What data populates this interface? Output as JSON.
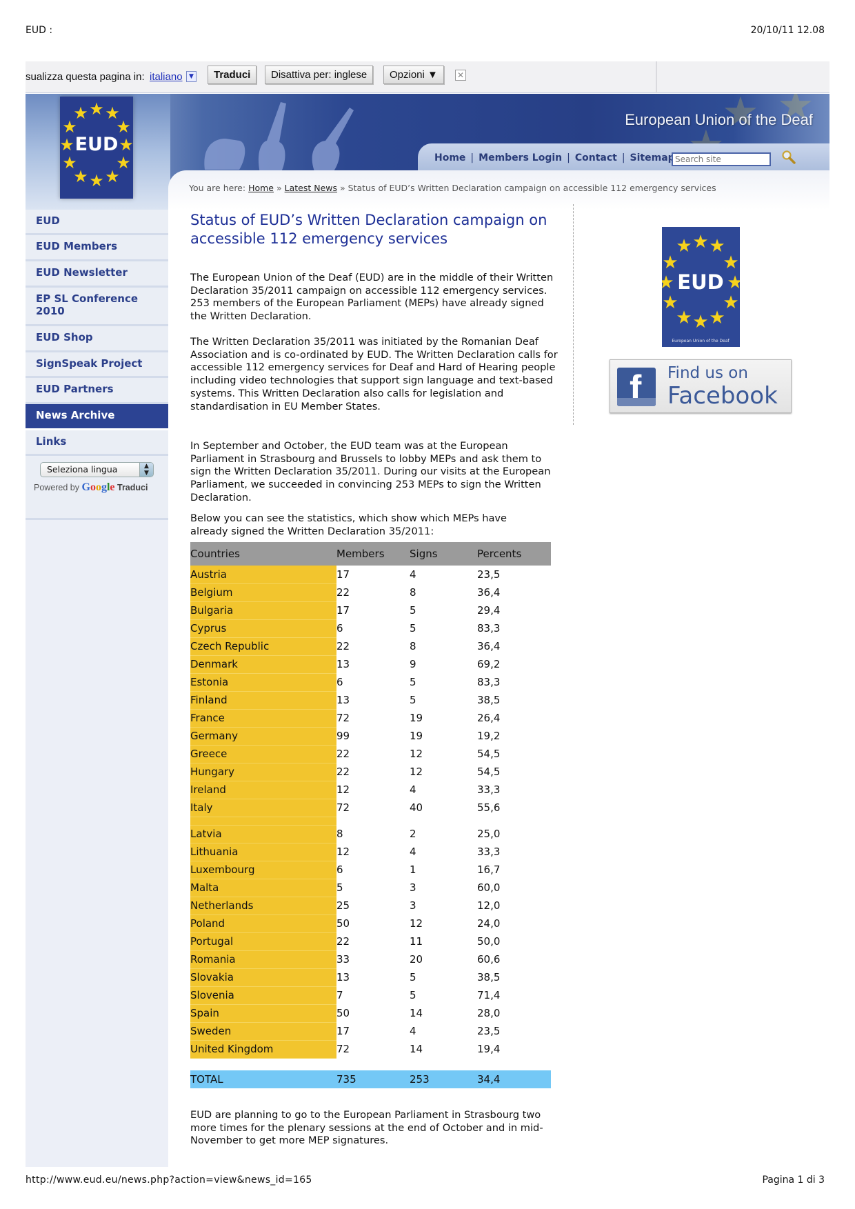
{
  "print_header": {
    "title": "EUD :",
    "datetime": "20/10/11 12.08"
  },
  "print_footer": {
    "url": "http://www.eud.eu/news.php?action=view&news_id=165",
    "page": "Pagina 1 di 3"
  },
  "translate_bar": {
    "label": "sualizza questa pagina in:",
    "language": "italiano",
    "translate_button": "Traduci",
    "disable_button": "Disattiva per: inglese",
    "options_button": "Opzioni ▼",
    "close_glyph": "✕"
  },
  "header": {
    "logo_text": "EUD",
    "site_title": "European Union of the Deaf",
    "nav": [
      "Home",
      "Members Login",
      "Contact",
      "Sitemap"
    ],
    "nav_separator": "|",
    "search_placeholder": "Search site"
  },
  "breadcrumb": {
    "prefix": "You are here:",
    "home": "Home",
    "sep": "»",
    "latest": "Latest News",
    "current": "Status of EUD’s Written Declaration campaign on accessible 112 emergency services"
  },
  "sidebar": {
    "items": [
      {
        "label": "EUD",
        "active": false
      },
      {
        "label": "EUD Members",
        "active": false
      },
      {
        "label": "EUD Newsletter",
        "active": false
      },
      {
        "label": "EP SL Conference 2010",
        "active": false
      },
      {
        "label": "EUD Shop",
        "active": false
      },
      {
        "label": "SignSpeak Project",
        "active": false
      },
      {
        "label": "EUD Partners",
        "active": false
      },
      {
        "label": "News Archive",
        "active": true
      },
      {
        "label": "Links",
        "active": false
      }
    ],
    "language_select": "Seleziona lingua",
    "powered_by": "Powered by",
    "google": "Google",
    "traduci": "Traduci"
  },
  "article": {
    "title": "Status of EUD’s Written Declaration campaign on accessible 112 emergency services",
    "paragraphs": [
      "The European Union of the Deaf (EUD) are in the middle of their Written Declaration 35/2011 campaign on accessible 112 emergency services. 253 members of the European Parliament (MEPs) have already signed the Written Declaration.",
      "The Written Declaration 35/2011 was initiated by the Romanian Deaf Association and is co-ordinated by EUD. The Written Declaration calls for accessible 112 emergency services for Deaf and Hard of Hearing people including video technologies that support sign language and text-based systems. This Written Declaration also calls for legislation and standardisation in EU Member States.",
      "In September and October, the EUD team was at the European Parliament in Strasbourg and Brussels to lobby MEPs and ask them to sign the Written Declaration 35/2011. During our visits at the European Parliament, we succeeded in convincing 253 MEPs to sign the Written Declaration.",
      "Below you can see the statistics, which show which MEPs have already signed the Written Declaration 35/2011:"
    ],
    "closing": "EUD are planning to go to the European Parliament in Strasbourg two more times for the plenary sessions at the end of October and in mid-November to get more MEP signatures."
  },
  "table": {
    "headers": [
      "Countries",
      "Members",
      "Signs",
      "Percents"
    ],
    "rows": [
      [
        "Austria",
        "17",
        "4",
        "23,5"
      ],
      [
        "Belgium",
        "22",
        "8",
        "36,4"
      ],
      [
        "Bulgaria",
        "17",
        "5",
        "29,4"
      ],
      [
        "Cyprus",
        "6",
        "5",
        "83,3"
      ],
      [
        "Czech Republic",
        "22",
        "8",
        "36,4"
      ],
      [
        "Denmark",
        "13",
        "9",
        "69,2"
      ],
      [
        "Estonia",
        "6",
        "5",
        "83,3"
      ],
      [
        "Finland",
        "13",
        "5",
        "38,5"
      ],
      [
        "France",
        "72",
        "19",
        "26,4"
      ],
      [
        "Germany",
        "99",
        "19",
        "19,2"
      ],
      [
        "Greece",
        "22",
        "12",
        "54,5"
      ],
      [
        "Hungary",
        "22",
        "12",
        "54,5"
      ],
      [
        "Ireland",
        "12",
        "4",
        "33,3"
      ],
      [
        "Italy",
        "72",
        "40",
        "55,6"
      ],
      [
        "Latvia",
        "8",
        "2",
        "25,0"
      ],
      [
        "Lithuania",
        "12",
        "4",
        "33,3"
      ],
      [
        "Luxembourg",
        "6",
        "1",
        "16,7"
      ],
      [
        "Malta",
        "5",
        "3",
        "60,0"
      ],
      [
        "Netherlands",
        "25",
        "3",
        "12,0"
      ],
      [
        "Poland",
        "50",
        "12",
        "24,0"
      ],
      [
        "Portugal",
        "22",
        "11",
        "50,0"
      ],
      [
        "Romania",
        "33",
        "20",
        "60,6"
      ],
      [
        "Slovakia",
        "13",
        "5",
        "38,5"
      ],
      [
        "Slovenia",
        "7",
        "5",
        "71,4"
      ],
      [
        "Spain",
        "50",
        "14",
        "28,0"
      ],
      [
        "Sweden",
        "17",
        "4",
        "23,5"
      ],
      [
        "United Kingdom",
        "72",
        "14",
        "19,4"
      ]
    ],
    "total": [
      "TOTAL",
      "735",
      "253",
      "34,4"
    ]
  },
  "right_column": {
    "logo_text": "EUD",
    "logo_caption": "European Union of the Deaf",
    "facebook_line1": "Find us on",
    "facebook_line2": "Facebook",
    "facebook_glyph": "f"
  },
  "colors": {
    "brand_blue": "#2c4393",
    "country_highlight": "#f2c52e",
    "total_highlight": "#74c8f6",
    "header_row": "#9b9b9b",
    "title_blue": "#1d2f96"
  }
}
